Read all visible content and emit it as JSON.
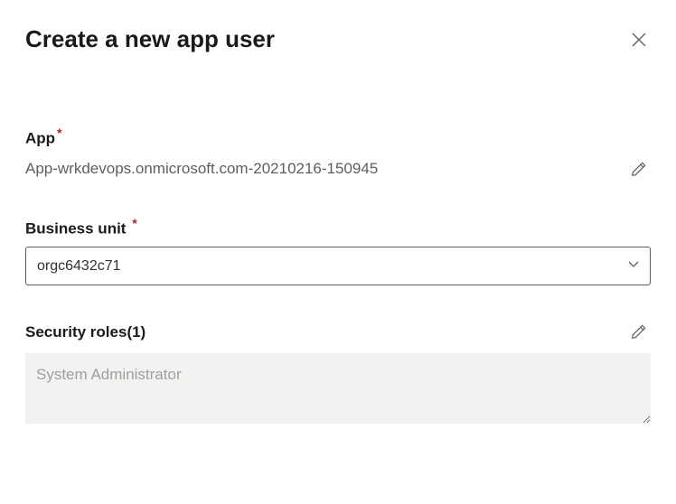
{
  "header": {
    "title": "Create a new app user"
  },
  "app": {
    "label": "App",
    "value": "App-wrkdevops.onmicrosoft.com-20210216-150945"
  },
  "businessUnit": {
    "label": "Business unit",
    "selected": "orgc6432c71"
  },
  "securityRoles": {
    "label": "Security roles(1)",
    "value": "System Administrator"
  }
}
